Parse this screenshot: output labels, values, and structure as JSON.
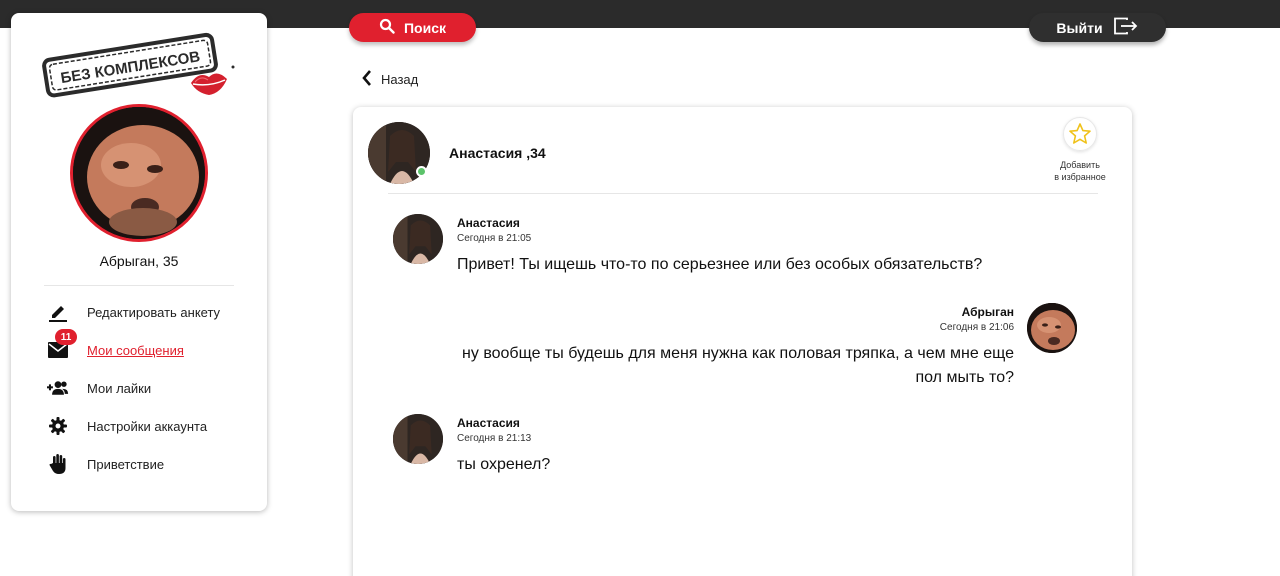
{
  "header": {
    "search_label": "Поиск",
    "logout_label": "Выйти"
  },
  "sidebar": {
    "logo_text": "БЕЗ КОМПЛЕКСОВ",
    "profile_name": "Абрыган, 35",
    "menu": [
      {
        "label": "Редактировать анкету",
        "icon": "edit-icon"
      },
      {
        "label": "Мои сообщения",
        "icon": "mail-icon",
        "badge": "11",
        "active": true
      },
      {
        "label": "Мои лайки",
        "icon": "add-users-icon"
      },
      {
        "label": "Настройки аккаунта",
        "icon": "gear-icon"
      },
      {
        "label": "Приветствие",
        "icon": "hand-icon"
      }
    ]
  },
  "chat": {
    "back_label": "Назад",
    "partner_title": "Анастасия ,34",
    "favorite_line1": "Добавить",
    "favorite_line2": "в избранное",
    "messages": [
      {
        "author": "Анастасия",
        "time": "Сегодня в 21:05",
        "text": "Привет! Ты ищешь что-то по серьезнее или без особых обязательств?",
        "side": "left"
      },
      {
        "author": "Абрыган",
        "time": "Сегодня в 21:06",
        "text_line1": "ну вообще ты будешь для меня нужна как половая тряпка, а чем мне еще",
        "text_line2": "пол мыть то?",
        "side": "right"
      },
      {
        "author": "Анастасия",
        "time": "Сегодня в 21:13",
        "text": "ты охренел?",
        "side": "left"
      }
    ]
  },
  "colors": {
    "accent": "#e0202e",
    "topbar": "#2b2b2b",
    "online": "#5cc36a"
  }
}
